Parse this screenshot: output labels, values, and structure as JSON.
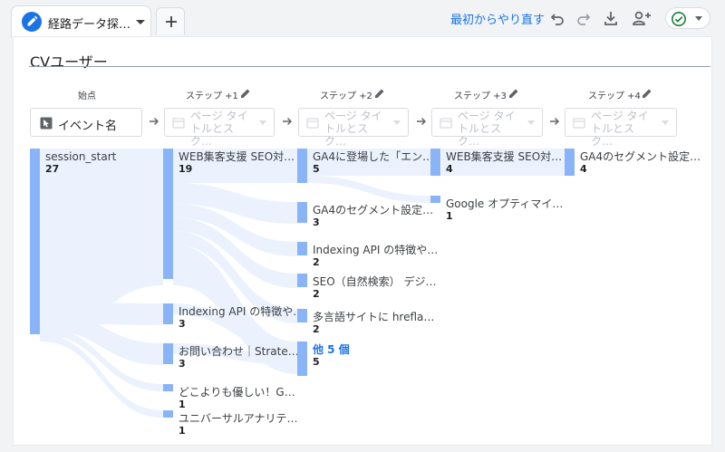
{
  "tab": {
    "label": "経路データ探…",
    "icon": "pencil-icon"
  },
  "toolbar": {
    "restart_label": "最初からやり直す",
    "icons": [
      "undo-icon",
      "redo-icon",
      "download-icon",
      "share-user-icon",
      "check-circle-icon"
    ]
  },
  "colors": {
    "accent": "#1a73e8",
    "node": "#8ab4f8",
    "flow": "#e8f0fe",
    "status": "#188038"
  },
  "canvas": {
    "title": "CVユーザー"
  },
  "steps": [
    {
      "label": "始点",
      "selector": "イベント名",
      "disabled": false
    },
    {
      "label": "ステップ +1",
      "selector": "ページ タイトルとスク…",
      "disabled": true
    },
    {
      "label": "ステップ +2",
      "selector": "ページ タイトルとスク…",
      "disabled": true
    },
    {
      "label": "ステップ +3",
      "selector": "ページ タイトルとスク…",
      "disabled": true
    },
    {
      "label": "ステップ +4",
      "selector": "ページ タイトルとスク…",
      "disabled": true
    }
  ],
  "columns": [
    [
      {
        "label": "session_start",
        "value": "27"
      }
    ],
    [
      {
        "label": "WEB集客支援 SEO対…",
        "value": "19"
      },
      {
        "label": "Indexing API の特徴や…",
        "value": "3"
      },
      {
        "label": "お問い合わせ｜Strate…",
        "value": "3"
      },
      {
        "label": "どこよりも優しい！G…",
        "value": "1"
      },
      {
        "label": "ユニバーサルアナリテ…",
        "value": "1"
      }
    ],
    [
      {
        "label": "GA4に登場した「エン…",
        "value": "5"
      },
      {
        "label": "GA4のセグメント設定…",
        "value": "3"
      },
      {
        "label": "Indexing API の特徴や…",
        "value": "2"
      },
      {
        "label": "SEO（自然検索） デジ…",
        "value": "2"
      },
      {
        "label": "多言語サイトに hrefla…",
        "value": "2"
      },
      {
        "label": "他 5 個",
        "value": "5",
        "more": true
      }
    ],
    [
      {
        "label": "WEB集客支援 SEO対…",
        "value": "4"
      },
      {
        "label": "Google オプティマイ…",
        "value": "1"
      }
    ],
    [
      {
        "label": "GA4のセグメント設定…",
        "value": "4"
      }
    ]
  ]
}
